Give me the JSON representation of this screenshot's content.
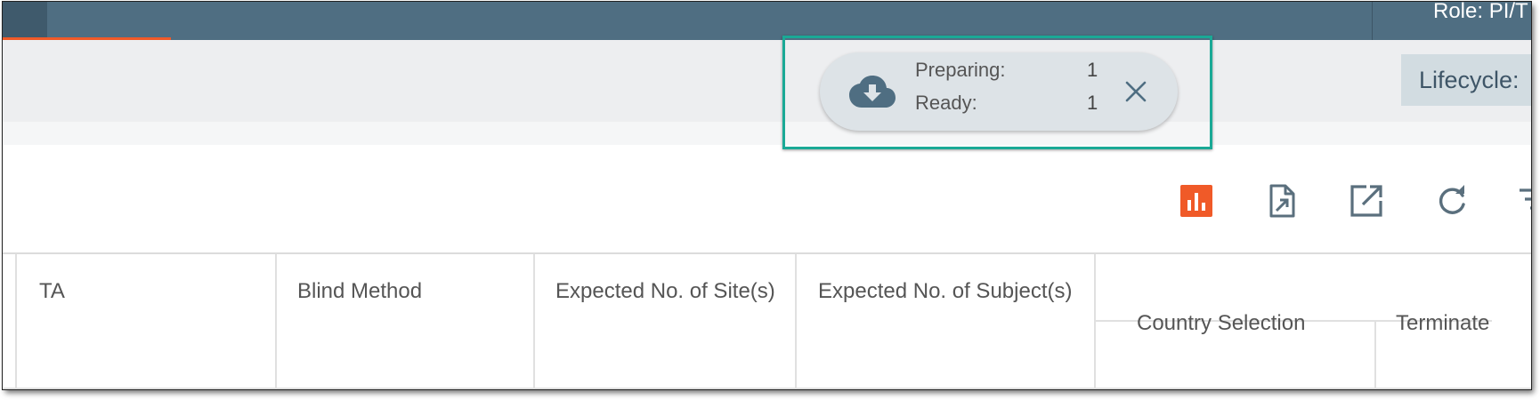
{
  "topbar": {
    "role_text": "Role: PI/T",
    "accent_color": "#f05a28"
  },
  "subbar": {
    "lifecycle_label": "Lifecycle:"
  },
  "download_notifier": {
    "icon": "cloud-download-icon",
    "rows": [
      {
        "label": "Preparing:",
        "count": "1"
      },
      {
        "label": "Ready:",
        "count": "1"
      }
    ],
    "close_icon": "close-icon",
    "highlight_color": "#1aa996"
  },
  "toolbar": {
    "icons": [
      "bar-chart-icon",
      "file-export-icon",
      "open-external-icon",
      "refresh-icon",
      "filter-icon"
    ],
    "active_color": "#f05a28"
  },
  "table": {
    "headers": {
      "ta": "TA",
      "blind_method": "Blind Method",
      "expected_sites": "Expected No. of Site(s)",
      "expected_subjects": "Expected No. of Subject(s)",
      "country_selection": "Country Selection",
      "terminate": "Terminate"
    }
  }
}
